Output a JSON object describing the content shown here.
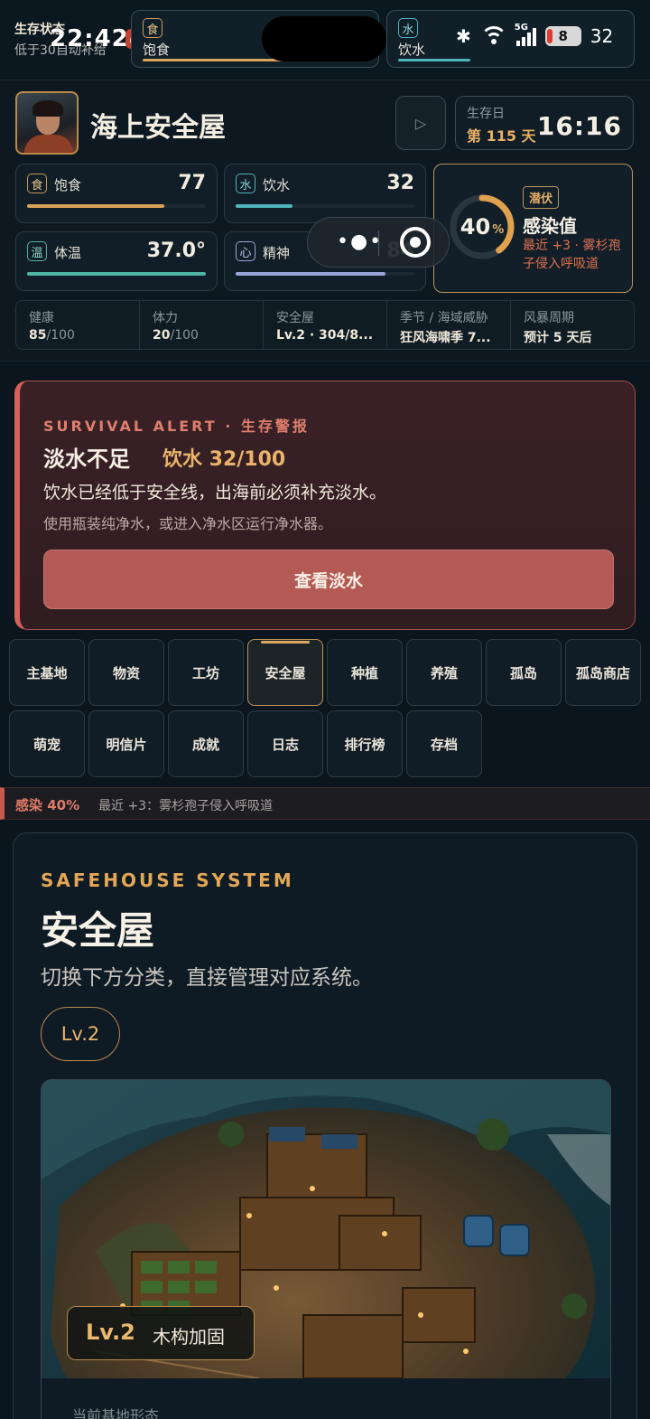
{
  "status_strip": {
    "label_top": "生存状态",
    "label_sub": "低于30自动补给",
    "clock": "22:42",
    "food": {
      "icon": "食",
      "label": "饱食",
      "level": 0.72
    },
    "water": {
      "icon": "水",
      "label": "饮水",
      "level": 0.32
    },
    "battery": "8",
    "battery_extra": "32",
    "network": "5G"
  },
  "header": {
    "title": "海上安全屋",
    "play_icon": "▷",
    "day_label": "生存日",
    "day_value": "第 115 天",
    "time": "16:16"
  },
  "stats": [
    {
      "icon": "食",
      "label": "饱食",
      "value": "77",
      "level": 0.77,
      "color": "#d9a35a"
    },
    {
      "icon": "水",
      "label": "饮水",
      "value": "32",
      "level": 0.32,
      "color": "#4fb3bb"
    },
    {
      "icon": "温",
      "label": "体温",
      "value": "37.0°",
      "level": 1.0,
      "color": "#4fb3a2"
    },
    {
      "icon": "心",
      "label": "精神",
      "value": "84",
      "level": 0.84,
      "color": "#9aa3d8"
    }
  ],
  "infection": {
    "percent": "40",
    "percent_sign": "%",
    "level": 0.4,
    "tag": "潜伏",
    "title": "感染值",
    "note": "最近 +3 · 雾杉孢子侵入呼吸道"
  },
  "info_row": [
    {
      "label": "健康",
      "value": "85",
      "suffix": "/100"
    },
    {
      "label": "体力",
      "value": "20",
      "suffix": "/100"
    },
    {
      "label": "安全屋",
      "value": "Lv.2 · 304/8...",
      "suffix": ""
    },
    {
      "label": "季节 / 海域威胁",
      "value": "狂风海啸季 7...",
      "suffix": ""
    },
    {
      "label": "风暴周期",
      "value": "预计 5 天后",
      "suffix": ""
    }
  ],
  "alert": {
    "eyebrow": "SURVIVAL ALERT · 生存警报",
    "title": "淡水不足",
    "metric": "饮水 32/100",
    "desc": "饮水已经低于安全线，出海前必须补充淡水。",
    "sub": "使用瓶装纯净水，或进入净水区运行净水器。",
    "button": "查看淡水"
  },
  "nav": {
    "row1": [
      "主基地",
      "物资",
      "工坊",
      "安全屋",
      "种植",
      "养殖",
      "孤岛",
      "孤岛商店"
    ],
    "row2": [
      "萌宠",
      "明信片",
      "成就",
      "日志",
      "排行榜",
      "存档"
    ],
    "active": "安全屋"
  },
  "ticker": {
    "alert": "感染 40%",
    "text": "最近 +3：雾杉孢子侵入呼吸道"
  },
  "safehouse": {
    "eyebrow": "SAFEHOUSE SYSTEM",
    "title": "安全屋",
    "desc": "切换下方分类，直接管理对应系统。",
    "level_pill": "Lv.2",
    "badge_level": "Lv.2",
    "badge_name": "木构加固",
    "footer_hint": "当前基地形态"
  },
  "colors": {
    "accent_gold": "#e4a756",
    "alert_red": "#d4615a",
    "water_teal": "#4fb3bb"
  }
}
